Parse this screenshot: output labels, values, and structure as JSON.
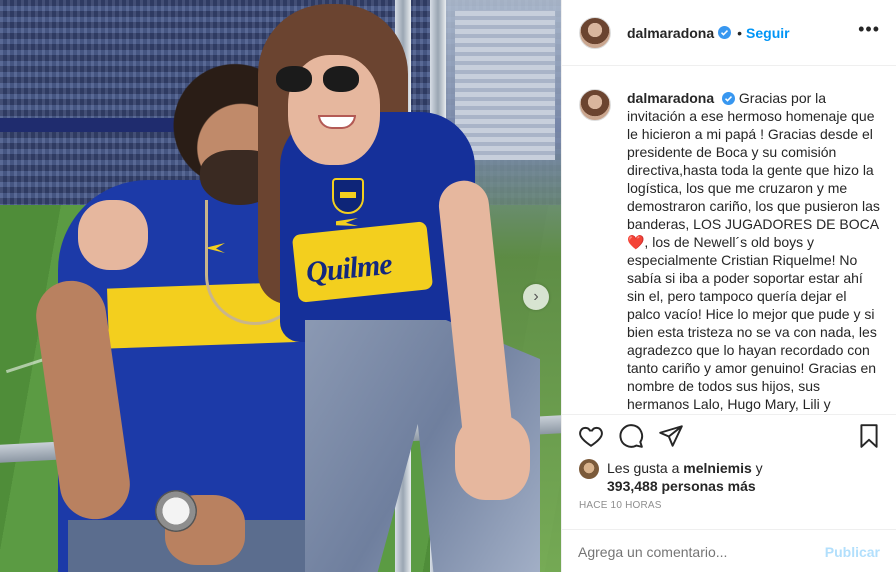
{
  "post": {
    "username": "dalmaradona",
    "header_separator": "•",
    "follow_label": "Seguir",
    "more_label": "•••",
    "caption_text": "Gracias por la invitación a ese hermoso homenaje que le hicieron a mi papá ! Gracias desde el presidente de Boca y su comisión directiva,hasta toda la gente que hizo la logística, los que me cruzaron y me demostraron cariño, los que pusieron las banderas, LOS JUGADORES DE BOCA❤️, los de Newell´s old boys y especialmente Cristian Riquelme! No sabía si iba a poder soportar estar ahí sin el, pero tampoco quería dejar el palco vacío! Hice lo mejor que pude y si bien esta tristeza no se va con nada, les agradezco que lo hayan recordado con tanto cariño y amor genuino! Gracias en nombre de todos sus hijos, sus hermanos Lalo, Hugo Mary, Lili y"
  },
  "photo": {
    "shirt_text": "Quilme"
  },
  "likes": {
    "prefix": "Les gusta a",
    "liker": "melniemis",
    "conjunction": "y",
    "count": "393,488",
    "suffix": "personas más"
  },
  "timestamp": "HACE 10 HORAS",
  "comment": {
    "placeholder": "Agrega un comentario...",
    "publish_label": "Publicar"
  },
  "icons": {
    "next": "chevron-right-icon",
    "like": "heart-icon",
    "comment": "comment-bubble-icon",
    "share": "paper-plane-icon",
    "save": "bookmark-icon",
    "verified": "verified-badge-icon",
    "more": "more-dots-icon"
  },
  "colors": {
    "accent": "#0095f6",
    "publish_disabled": "#b2dffc",
    "verified": "#3897f0",
    "heart": "#ed4956",
    "boca_blue": "#1c3aa8",
    "boca_yellow": "#f3cf1e"
  }
}
